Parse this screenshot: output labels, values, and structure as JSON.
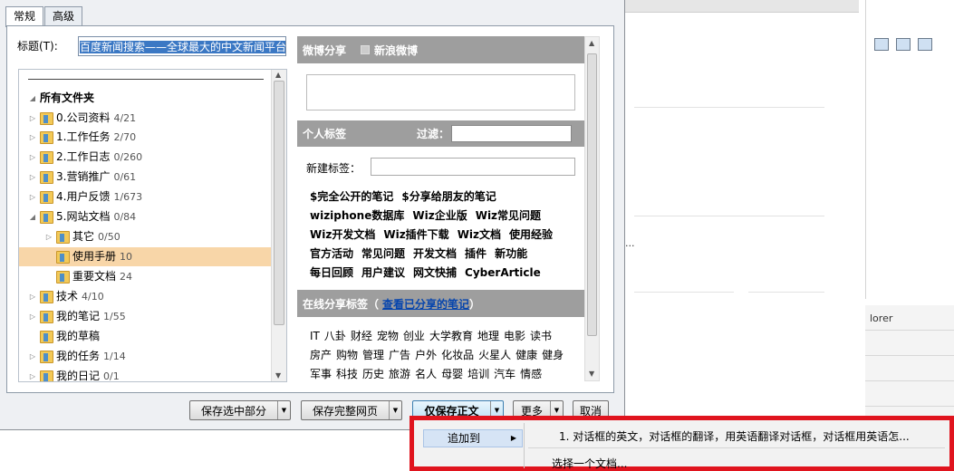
{
  "background": {
    "snippet_text": "...",
    "right_text": "lorer"
  },
  "dialog": {
    "tabs": [
      "常规",
      "高级"
    ],
    "title_label": "标题(T):",
    "title_value": "百度新闻搜索——全球最大的中文新闻平台",
    "tree": {
      "root": "所有文件夹",
      "items": [
        {
          "name": "0.公司资料",
          "count": "4/21"
        },
        {
          "name": "1.工作任务",
          "count": "2/70"
        },
        {
          "name": "2.工作日志",
          "count": "0/260"
        },
        {
          "name": "3.营销推广",
          "count": "0/61"
        },
        {
          "name": "4.用户反馈",
          "count": "1/673"
        },
        {
          "name": "5.网站文档",
          "count": "0/84"
        },
        {
          "name": "其它",
          "count": "0/50"
        },
        {
          "name": "使用手册",
          "count": "10"
        },
        {
          "name": "重要文档",
          "count": "24"
        },
        {
          "name": "技术",
          "count": "4/10"
        },
        {
          "name": "我的笔记",
          "count": "1/55"
        },
        {
          "name": "我的草稿",
          "count": ""
        },
        {
          "name": "我的任务",
          "count": "1/14"
        },
        {
          "name": "我的日记",
          "count": "0/1"
        }
      ]
    },
    "share": {
      "weibo_title": "微博分享",
      "weibo_option": "新浪微博",
      "tags_title": "个人标签",
      "filter_label": "过滤：",
      "newtag_label": "新建标签：",
      "tag_rows": [
        [
          "$完全公开的笔记",
          "$分享给朋友的笔记"
        ],
        [
          "wiziphone数据库",
          "Wiz企业版",
          "Wiz常见问题"
        ],
        [
          "Wiz开发文档",
          "Wiz插件下载",
          "Wiz文档",
          "使用经验"
        ],
        [
          "官方活动",
          "常见问题",
          "开发文档",
          "插件",
          "新功能"
        ],
        [
          "每日回顾",
          "用户建议",
          "网文快捕",
          "CyberArticle"
        ]
      ],
      "online_title": "在线分享标签（",
      "online_link": "查看已分享的笔记",
      "online_close": "）",
      "public_rows": [
        [
          "IT",
          "八卦",
          "财经",
          "宠物",
          "创业",
          "大学教育",
          "地理",
          "电影",
          "读书"
        ],
        [
          "房产",
          "购物",
          "管理",
          "广告",
          "户外",
          "化妆品",
          "火星人",
          "健康",
          "健身"
        ],
        [
          "军事",
          "科技",
          "历史",
          "旅游",
          "名人",
          "母婴",
          "培训",
          "汽车",
          "情感"
        ]
      ]
    },
    "buttons": {
      "save_selection": "保存选中部分",
      "save_full": "保存完整网页",
      "save_body": "仅保存正文",
      "more": "更多",
      "cancel": "取消"
    }
  },
  "popup": {
    "add_to": "追加到",
    "recent_doc": "1. 对话框的英文，对话框的翻译，用英语翻译对话框，对话框用英语怎...",
    "choose_doc": "选择一个文档..."
  }
}
